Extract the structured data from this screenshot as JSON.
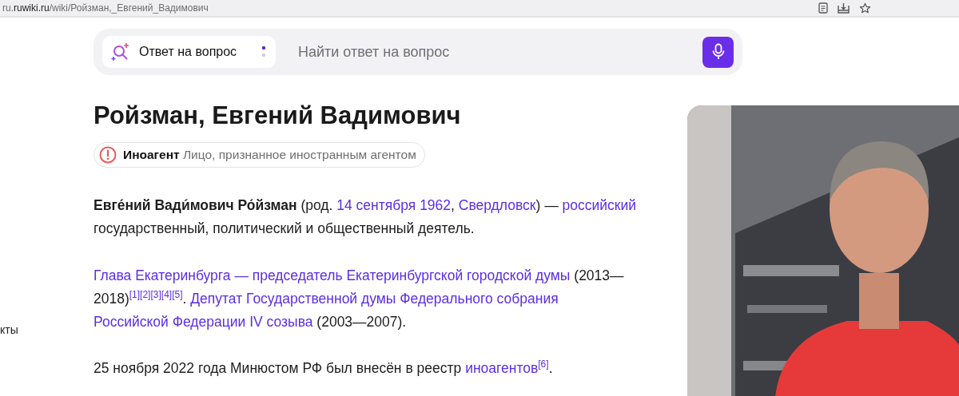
{
  "browser": {
    "url_host_prefix": "ru.",
    "url_host": "ruwiki.ru",
    "url_path": "/wiki/Ройзман,_Евгений_Вадимович"
  },
  "search": {
    "mode": "Ответ на вопрос",
    "placeholder": "Найти ответ на вопрос"
  },
  "sidebar": {
    "fragment": "кты"
  },
  "article": {
    "title": "Ройзман, Евгений Вадимович",
    "badge": {
      "label": "Иноагент",
      "description": "Лицо, признанное иностранным агентом"
    },
    "paragraphs": [
      [
        {
          "kind": "bold",
          "text": "Евге́ний Вади́мович Ро́йзман"
        },
        {
          "kind": "text",
          "text": " (род. "
        },
        {
          "kind": "link",
          "text": "14 сентября 1962"
        },
        {
          "kind": "text",
          "text": ", "
        },
        {
          "kind": "link",
          "text": "Свердловск"
        },
        {
          "kind": "text",
          "text": ") — "
        },
        {
          "kind": "link",
          "text": "российский"
        },
        {
          "kind": "text",
          "text": " государственный, политический и общественный деятель."
        }
      ],
      [
        {
          "kind": "link",
          "text": "Глава Екатеринбурга — председатель Екатеринбургской городской думы"
        },
        {
          "kind": "text",
          "text": " (2013—2018)"
        },
        {
          "kind": "ref",
          "text": "[1]"
        },
        {
          "kind": "ref",
          "text": "[2]"
        },
        {
          "kind": "ref",
          "text": "[3]"
        },
        {
          "kind": "ref",
          "text": "[4]"
        },
        {
          "kind": "ref",
          "text": "[5]"
        },
        {
          "kind": "text",
          "text": ". "
        },
        {
          "kind": "link",
          "text": "Депутат Государственной думы Федерального собрания"
        },
        {
          "kind": "link",
          "text": "Российской Федерации IV созыва"
        },
        {
          "kind": "text",
          "text": " (2003—2007)."
        }
      ],
      [
        {
          "kind": "text",
          "text": "25 ноября 2022 года Минюстом РФ был внесён в реестр "
        },
        {
          "kind": "link",
          "text": "иноагентов"
        },
        {
          "kind": "ref",
          "text": "[6]"
        },
        {
          "kind": "text",
          "text": "."
        }
      ]
    ]
  }
}
